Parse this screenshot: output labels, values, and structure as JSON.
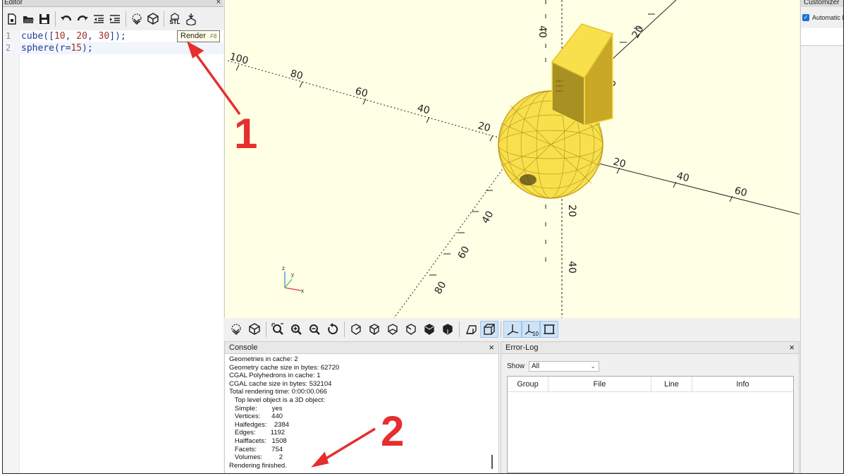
{
  "editor": {
    "title": "Editor",
    "close": "×",
    "lines": [
      {
        "num": "1",
        "parts": [
          {
            "t": "cube([",
            "c": "kw"
          },
          {
            "t": "10",
            "c": "nm"
          },
          {
            "t": ", ",
            "c": "kw"
          },
          {
            "t": "20",
            "c": "nm"
          },
          {
            "t": ", ",
            "c": "kw"
          },
          {
            "t": "30",
            "c": "nm"
          },
          {
            "t": "]);",
            "c": "kw"
          }
        ]
      },
      {
        "num": "2",
        "parts": [
          {
            "t": "sphere(r=",
            "c": "kw"
          },
          {
            "t": "15",
            "c": "nm"
          },
          {
            "t": ");",
            "c": "kw"
          }
        ]
      }
    ],
    "tooltip": {
      "label": "Render",
      "shortcut": "F6"
    },
    "toolbar_icons": [
      "new-file-icon",
      "open-file-icon",
      "save-icon",
      "undo-icon",
      "redo-icon",
      "unindent-icon",
      "indent-icon",
      "preview-icon",
      "render-icon",
      "export-stl-icon",
      "send-to-print-icon"
    ],
    "stl_label": "STL"
  },
  "viewport": {
    "x_ticks": [
      "100",
      "80",
      "60",
      "40",
      "20",
      "20",
      "40",
      "60"
    ],
    "y_ticks": [
      "40",
      "60",
      "80",
      "20",
      "40"
    ],
    "z_ticks": [
      "40",
      "60",
      "20",
      "40"
    ],
    "axes_indicator": {
      "z": "z",
      "y": "y",
      "x": "x"
    },
    "colors": {
      "background": "#ffffe5",
      "object": "#f8e04c",
      "object_dark": "#c9a726"
    }
  },
  "view_toolbar": {
    "icons": [
      "preview-icon",
      "render-icon",
      "view-all-icon",
      "zoom-in-icon",
      "zoom-out-icon",
      "reset-view-icon",
      "view-right-icon",
      "view-top-icon",
      "view-bottom-icon",
      "view-left-icon",
      "view-front-icon",
      "view-back-icon",
      "perspective-icon",
      "orthogonal-icon",
      "show-axes-icon",
      "show-scale-markers-icon",
      "show-edges-icon"
    ],
    "scale_label": "10"
  },
  "console": {
    "title": "Console",
    "close": "×",
    "rows": [
      "Geometries in cache: 2",
      "Geometry cache size in bytes: 62720",
      "CGAL Polyhedrons in cache: 1",
      "CGAL cache size in bytes: 532104",
      "Total rendering time: 0:00:00.066",
      "   Top level object is a 3D object:",
      "   Simple:        yes",
      "   Vertices:      440",
      "   Halfedges:    2384",
      "   Edges:        1192",
      "   Halffacets:   1508",
      "   Facets:        754",
      "   Volumes:         2",
      "Rendering finished."
    ]
  },
  "errorlog": {
    "title": "Error-Log",
    "close": "×",
    "show_label": "Show",
    "show_value": "All",
    "columns": [
      "Group",
      "File",
      "Line",
      "Info"
    ]
  },
  "customizer": {
    "title": "Customizer",
    "auto_preview": "Automatic Preview"
  },
  "annotations": [
    "1",
    "2"
  ]
}
